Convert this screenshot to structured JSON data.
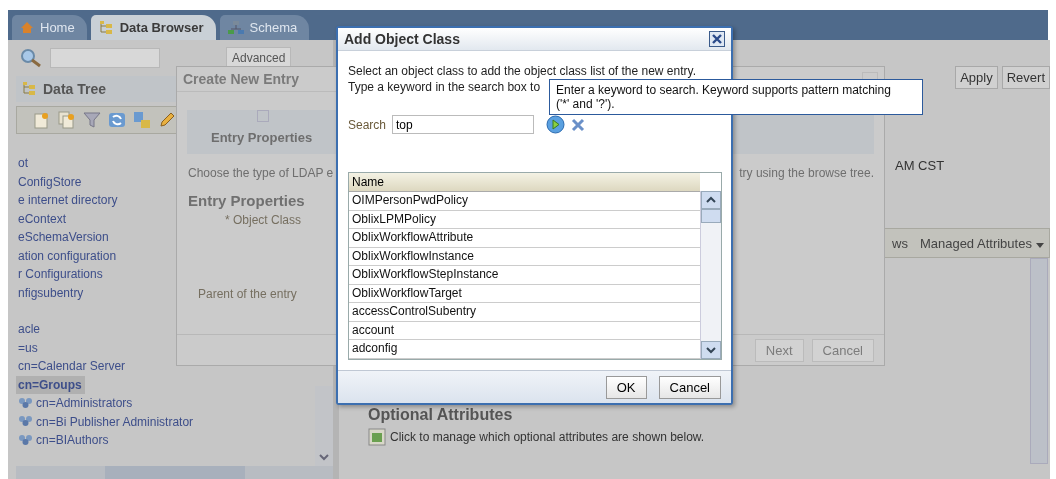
{
  "tabs": [
    {
      "label": "Home",
      "kind": "home",
      "selected": false
    },
    {
      "label": "Data Browser",
      "kind": "tree",
      "selected": true
    },
    {
      "label": "Schema",
      "kind": "schema",
      "selected": false
    }
  ],
  "left_panel": {
    "advanced_button": "Advanced",
    "title": "Data Tree",
    "items": [
      {
        "label": "ot",
        "kind": "entry",
        "selected": false
      },
      {
        "label": "ConfigStore",
        "kind": "entry",
        "selected": false
      },
      {
        "label": "e internet directory",
        "kind": "entry",
        "selected": false
      },
      {
        "label": "eContext",
        "kind": "entry",
        "selected": false
      },
      {
        "label": "eSchemaVersion",
        "kind": "entry",
        "selected": false
      },
      {
        "label": "ation configuration",
        "kind": "entry",
        "selected": false
      },
      {
        "label": "r Configurations",
        "kind": "entry",
        "selected": false
      },
      {
        "label": "nfigsubentry",
        "kind": "entry",
        "selected": false
      },
      {
        "label": "acle",
        "kind": "entry",
        "selected": false
      },
      {
        "label": "=us",
        "kind": "entry",
        "selected": false
      },
      {
        "label": "cn=Calendar Server",
        "kind": "entry",
        "selected": false
      },
      {
        "label": "cn=Groups",
        "kind": "entry",
        "selected": true
      },
      {
        "label": "cn=Administrators",
        "kind": "group",
        "selected": false
      },
      {
        "label": "cn=Bi Publisher Administrator",
        "kind": "group",
        "selected": false
      },
      {
        "label": "cn=BIAuthors",
        "kind": "group",
        "selected": false
      }
    ]
  },
  "main": {
    "apply_button": "Apply",
    "revert_button": "Revert",
    "timestamp": "AM CST",
    "toolbar_fragment": "ws",
    "menu": "Managed Attributes",
    "optional_title": "Optional Attributes",
    "optional_hint": "Click to manage which optional attributes are shown below."
  },
  "create_dialog": {
    "title": "Create New Entry",
    "step": "Entry Properties",
    "intro_start": "Choose the type of LDAP e",
    "intro_end": "try using the browse tree.",
    "heading": "Entry Properties",
    "object_class_label": "* Object Class",
    "parent_label": "Parent of the entry",
    "buttons": [
      {
        "label": "Next",
        "disabled": true
      },
      {
        "label": "Cancel",
        "disabled": true
      }
    ]
  },
  "add_dialog": {
    "title": "Add Object Class",
    "line_1": "Select an object class to add the object class list of the new entry.",
    "line_2": "Type a keyword in the search box to",
    "search_label": "Search",
    "search_value": "top",
    "column": "Name",
    "rows": [
      "OIMPersonPwdPolicy",
      "OblixLPMPolicy",
      "OblixWorkflowAttribute",
      "OblixWorkflowInstance",
      "OblixWorkflowStepInstance",
      "OblixWorkflowTarget",
      "accessControlSubentry",
      "account",
      "adconfig"
    ],
    "buttons": [
      "OK",
      "Cancel"
    ]
  },
  "tooltip": {
    "line_1": "Enter a keyword to search. Keyword supports pattern matching",
    "line_2": "('*' and '?')."
  }
}
